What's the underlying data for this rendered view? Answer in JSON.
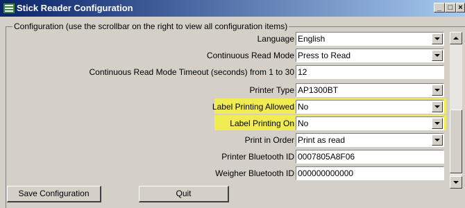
{
  "window": {
    "title": "Stick Reader Configuration",
    "min_glyph": "_",
    "max_glyph": "□",
    "close_glyph": "×"
  },
  "group": {
    "label": "Configuration (use the scrollbar on the right to view all configuration items)"
  },
  "fields": [
    {
      "label": "Language",
      "value": "English",
      "type": "dropdown",
      "highlighted": false
    },
    {
      "label": "Continuous Read Mode",
      "value": "Press to Read",
      "type": "dropdown",
      "highlighted": false
    },
    {
      "label": "Continuous Read Mode Timeout (seconds) from 1 to 30",
      "value": "12",
      "type": "text",
      "highlighted": false
    },
    {
      "label": "Printer Type",
      "value": "AP1300BT",
      "type": "dropdown",
      "highlighted": false
    },
    {
      "label": "Label Printing Allowed",
      "value": "No",
      "type": "dropdown",
      "highlighted": true
    },
    {
      "label": "Label Printing On",
      "value": "No",
      "type": "dropdown",
      "highlighted": true
    },
    {
      "label": "Print in Order",
      "value": "Print as read",
      "type": "dropdown",
      "highlighted": false
    },
    {
      "label": "Printer Bluetooth ID",
      "value": "0007805A8F06",
      "type": "text",
      "highlighted": false
    },
    {
      "label": "Weigher Bluetooth ID",
      "value": "000000000000",
      "type": "text",
      "highlighted": false
    }
  ],
  "buttons": {
    "save": "Save Configuration",
    "quit": "Quit"
  },
  "colors": {
    "title_start": "#0a246a",
    "title_end": "#a6caf0",
    "highlight": "#f2ec53",
    "face": "#d4d0c8"
  },
  "icons": {
    "app": "stick-reader-app-icon",
    "dropdown": "chevron-down-icon",
    "scroll_up": "scroll-up-arrow-icon",
    "scroll_down": "scroll-down-arrow-icon"
  }
}
